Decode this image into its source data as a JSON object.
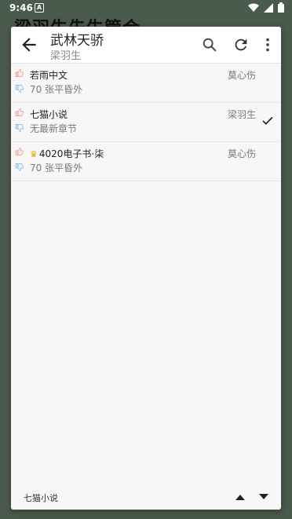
{
  "status_bar": {
    "time": "9:46",
    "notification_glyph": "A",
    "icons": [
      "wifi-icon",
      "signal-icon",
      "battery-icon"
    ]
  },
  "background": {
    "title": "梁羽生先生管合"
  },
  "toolbar": {
    "title": "武林天骄",
    "subtitle": "梁羽生",
    "icons": [
      "back-arrow-icon",
      "search-icon",
      "refresh-icon",
      "more-vert-icon"
    ]
  },
  "sources": [
    {
      "name": "若雨中文",
      "latest": "70 张平昏外",
      "author": "莫心伤",
      "selected": false,
      "crown": false
    },
    {
      "name": "七猫小说",
      "latest": "无最新章节",
      "author": "梁羽生",
      "selected": true,
      "crown": false
    },
    {
      "name": "4020电子书·柒",
      "latest": "70 张平昏外",
      "author": "莫心伤",
      "selected": false,
      "crown": true
    }
  ],
  "footer": {
    "current_source": "七猫小说",
    "icons": [
      "arrow-up-icon",
      "arrow-down-icon"
    ]
  },
  "colors": {
    "backdrop": "#4a5a4c",
    "dialog": "#f7f7f7",
    "thumb_up": "#f2a0a0",
    "thumb_down": "#8fc3e8",
    "crown": "#e0a800"
  }
}
